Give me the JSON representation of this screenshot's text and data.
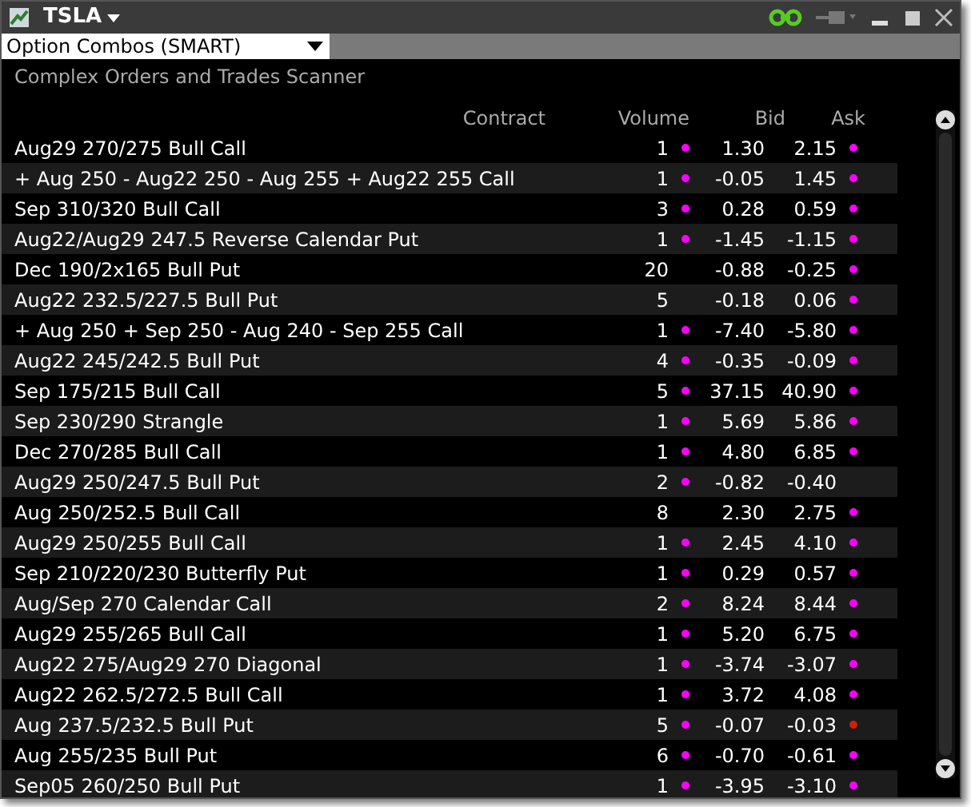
{
  "window": {
    "title": "TSLA"
  },
  "scanner_select": {
    "value": "Option Combos (SMART)"
  },
  "subtitle": "Complex Orders and Trades Scanner",
  "table": {
    "columns": [
      "Contract",
      "Volume",
      "Bid",
      "Ask"
    ],
    "rows": [
      {
        "contract": "Aug29 270/275 Bull Call",
        "volume": "1",
        "bid": "1.30",
        "ask": "2.15",
        "bid_tick": {
          "color": "#ff00ff"
        },
        "ask_tick": {
          "color": "#ff00ff"
        }
      },
      {
        "contract": "+ Aug 250 - Aug22 250 - Aug 255 + Aug22 255 Call",
        "volume": "1",
        "bid": "-0.05",
        "ask": "1.45",
        "bid_tick": {
          "color": "#ff00ff"
        },
        "ask_tick": {
          "color": "#ff00ff"
        }
      },
      {
        "contract": "Sep 310/320 Bull Call",
        "volume": "3",
        "bid": "0.28",
        "ask": "0.59",
        "bid_tick": {
          "color": "#ff00ff"
        },
        "ask_tick": {
          "color": "#ff00ff"
        }
      },
      {
        "contract": "Aug22/Aug29 247.5 Reverse Calendar Put",
        "volume": "1",
        "bid": "-1.45",
        "ask": "-1.15",
        "bid_tick": {
          "color": "#ff00ff"
        },
        "ask_tick": {
          "color": "#ff00ff"
        }
      },
      {
        "contract": "Dec 190/2x165 Bull Put",
        "volume": "20",
        "bid": "-0.88",
        "ask": "-0.25",
        "ask_tick": {
          "color": "#ff00ff"
        }
      },
      {
        "contract": "Aug22 232.5/227.5 Bull Put",
        "volume": "5",
        "bid": "-0.18",
        "ask": "0.06",
        "ask_tick": {
          "color": "#ff00ff"
        }
      },
      {
        "contract": "+ Aug 250 + Sep 250 - Aug 240 - Sep 255 Call",
        "volume": "1",
        "bid": "-7.40",
        "ask": "-5.80",
        "bid_tick": {
          "color": "#ff00ff"
        },
        "ask_tick": {
          "color": "#ff00ff"
        }
      },
      {
        "contract": "Aug22 245/242.5 Bull Put",
        "volume": "4",
        "bid": "-0.35",
        "ask": "-0.09",
        "bid_tick": {
          "color": "#ff00ff"
        },
        "ask_tick": {
          "color": "#ff00ff"
        }
      },
      {
        "contract": "Sep 175/215 Bull Call",
        "volume": "5",
        "bid": "37.15",
        "ask": "40.90",
        "bid_tick": {
          "color": "#ff00ff"
        },
        "ask_tick": {
          "color": "#ff00ff"
        }
      },
      {
        "contract": "Sep 230/290 Strangle",
        "volume": "1",
        "bid": "5.69",
        "ask": "5.86",
        "bid_tick": {
          "color": "#ff00ff"
        },
        "ask_tick": {
          "color": "#ff00ff"
        }
      },
      {
        "contract": "Dec 270/285 Bull Call",
        "volume": "1",
        "bid": "4.80",
        "ask": "6.85",
        "bid_tick": {
          "color": "#ff00ff"
        },
        "ask_tick": {
          "color": "#ff00ff"
        }
      },
      {
        "contract": "Aug29 250/247.5 Bull Put",
        "volume": "2",
        "bid": "-0.82",
        "ask": "-0.40",
        "bid_tick": {
          "color": "#ff00ff"
        }
      },
      {
        "contract": "Aug 250/252.5 Bull Call",
        "volume": "8",
        "bid": "2.30",
        "ask": "2.75",
        "ask_tick": {
          "color": "#ff00ff"
        }
      },
      {
        "contract": "Aug29 250/255 Bull Call",
        "volume": "1",
        "bid": "2.45",
        "ask": "4.10",
        "bid_tick": {
          "color": "#ff00ff"
        },
        "ask_tick": {
          "color": "#ff00ff"
        }
      },
      {
        "contract": "Sep 210/220/230 Butterfly Put",
        "volume": "1",
        "bid": "0.29",
        "ask": "0.57",
        "bid_tick": {
          "color": "#ff00ff"
        },
        "ask_tick": {
          "color": "#ff00ff"
        }
      },
      {
        "contract": "Aug/Sep 270 Calendar Call",
        "volume": "2",
        "bid": "8.24",
        "ask": "8.44",
        "bid_tick": {
          "color": "#ff00ff"
        },
        "ask_tick": {
          "color": "#ff00ff"
        }
      },
      {
        "contract": "Aug29 255/265 Bull Call",
        "volume": "1",
        "bid": "5.20",
        "ask": "6.75",
        "bid_tick": {
          "color": "#ff00ff"
        },
        "ask_tick": {
          "color": "#ff00ff"
        }
      },
      {
        "contract": "Aug22 275/Aug29 270 Diagonal",
        "volume": "1",
        "bid": "-3.74",
        "ask": "-3.07",
        "bid_tick": {
          "color": "#ff00ff"
        },
        "ask_tick": {
          "color": "#ff00ff"
        }
      },
      {
        "contract": "Aug22 262.5/272.5 Bull Call",
        "volume": "1",
        "bid": "3.72",
        "ask": "4.08",
        "bid_tick": {
          "color": "#ff00ff"
        },
        "ask_tick": {
          "color": "#ff00ff"
        }
      },
      {
        "contract": "Aug 237.5/232.5 Bull Put",
        "volume": "5",
        "bid": "-0.07",
        "ask": "-0.03",
        "bid_tick": {
          "color": "#ff00ff"
        },
        "ask_tick": {
          "color": "#cc2200"
        }
      },
      {
        "contract": "Aug 255/235 Bull Put",
        "volume": "6",
        "bid": "-0.70",
        "ask": "-0.61",
        "bid_tick": {
          "color": "#ff00ff"
        },
        "ask_tick": {
          "color": "#ff00ff"
        }
      },
      {
        "contract": "Sep05 260/250 Bull Put",
        "volume": "1",
        "bid": "-3.95",
        "ask": "-3.10",
        "bid_tick": {
          "color": "#ff00ff"
        },
        "ask_tick": {
          "color": "#ff00ff"
        }
      }
    ]
  }
}
